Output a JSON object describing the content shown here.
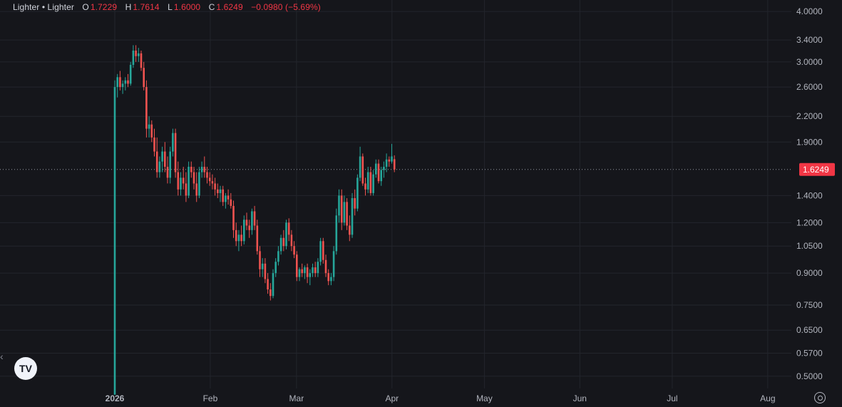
{
  "legend": {
    "symbol": "Lighter • Lighter",
    "open_label": "O",
    "open": "1.7229",
    "high_label": "H",
    "high": "1.7614",
    "low_label": "L",
    "low": "1.6000",
    "close_label": "C",
    "close": "1.6249",
    "change": "−0.0980 (−5.69%)"
  },
  "last_price_label": "1.6249",
  "icons": {
    "logo": "tradingview-logo-icon",
    "settings": "gear-icon",
    "collapse": "chevron-left-icon"
  },
  "colors": {
    "up": "#26a69a",
    "down": "#ef5350",
    "last_price": "#f23645",
    "background": "#15161b",
    "grid": "#23252c"
  },
  "chart_data": {
    "type": "candlestick",
    "y_scale": "log",
    "ylim": [
      0.47,
      4.1
    ],
    "y_ticks": [
      {
        "value": 4.0,
        "label": "4.0000"
      },
      {
        "value": 3.4,
        "label": "3.4000"
      },
      {
        "value": 3.0,
        "label": "3.0000"
      },
      {
        "value": 2.6,
        "label": "2.6000"
      },
      {
        "value": 2.2,
        "label": "2.2000"
      },
      {
        "value": 1.9,
        "label": "1.9000"
      },
      {
        "value": 1.4,
        "label": "1.4000"
      },
      {
        "value": 1.2,
        "label": "1.2000"
      },
      {
        "value": 1.05,
        "label": "1.0500"
      },
      {
        "value": 0.9,
        "label": "0.9000"
      },
      {
        "value": 0.75,
        "label": "0.7500"
      },
      {
        "value": 0.65,
        "label": "0.6500"
      },
      {
        "value": 0.57,
        "label": "0.5700"
      },
      {
        "value": 0.5,
        "label": "0.5000"
      }
    ],
    "x_ticks": [
      {
        "date": "2026-01-01",
        "label": "2026",
        "bold": true
      },
      {
        "date": "2026-02-01",
        "label": "Feb"
      },
      {
        "date": "2026-03-01",
        "label": "Mar"
      },
      {
        "date": "2026-04-01",
        "label": "Apr"
      },
      {
        "date": "2026-05-01",
        "label": "May"
      },
      {
        "date": "2026-06-01",
        "label": "Jun"
      },
      {
        "date": "2026-07-01",
        "label": "Jul"
      },
      {
        "date": "2026-08-01",
        "label": "Aug"
      }
    ],
    "last_price": 1.6249,
    "start_date": "2026-01-01",
    "candles": [
      [
        0.45,
        2.7,
        0.45,
        2.6
      ],
      [
        2.6,
        2.8,
        2.45,
        2.75
      ],
      [
        2.75,
        2.85,
        2.55,
        2.6
      ],
      [
        2.6,
        2.7,
        2.5,
        2.65
      ],
      [
        2.65,
        2.75,
        2.55,
        2.7
      ],
      [
        2.7,
        2.8,
        2.6,
        2.65
      ],
      [
        2.65,
        3.0,
        2.62,
        2.95
      ],
      [
        2.95,
        3.3,
        2.9,
        3.2
      ],
      [
        3.2,
        3.3,
        3.0,
        3.1
      ],
      [
        3.1,
        3.25,
        3.0,
        3.15
      ],
      [
        3.15,
        3.2,
        2.85,
        2.9
      ],
      [
        2.9,
        3.0,
        2.55,
        2.6
      ],
      [
        2.6,
        2.7,
        1.95,
        2.05
      ],
      [
        2.05,
        2.2,
        1.95,
        2.1
      ],
      [
        2.1,
        2.15,
        1.9,
        1.95
      ],
      [
        1.95,
        2.05,
        1.75,
        1.8
      ],
      [
        1.8,
        1.95,
        1.55,
        1.6
      ],
      [
        1.6,
        1.75,
        1.55,
        1.7
      ],
      [
        1.7,
        1.85,
        1.6,
        1.8
      ],
      [
        1.8,
        1.9,
        1.6,
        1.65
      ],
      [
        1.65,
        1.75,
        1.5,
        1.55
      ],
      [
        1.55,
        1.85,
        1.5,
        1.8
      ],
      [
        1.8,
        2.05,
        1.75,
        2.0
      ],
      [
        2.0,
        2.05,
        1.55,
        1.6
      ],
      [
        1.6,
        1.7,
        1.4,
        1.45
      ],
      [
        1.45,
        1.6,
        1.4,
        1.55
      ],
      [
        1.55,
        1.65,
        1.45,
        1.5
      ],
      [
        1.5,
        1.6,
        1.35,
        1.4
      ],
      [
        1.4,
        1.7,
        1.38,
        1.65
      ],
      [
        1.65,
        1.7,
        1.55,
        1.6
      ],
      [
        1.6,
        1.65,
        1.45,
        1.5
      ],
      [
        1.5,
        1.6,
        1.35,
        1.4
      ],
      [
        1.4,
        1.65,
        1.38,
        1.6
      ],
      [
        1.6,
        1.7,
        1.55,
        1.65
      ],
      [
        1.65,
        1.75,
        1.55,
        1.6
      ],
      [
        1.6,
        1.65,
        1.5,
        1.55
      ],
      [
        1.55,
        1.6,
        1.48,
        1.52
      ],
      [
        1.52,
        1.58,
        1.45,
        1.5
      ],
      [
        1.5,
        1.55,
        1.4,
        1.45
      ],
      [
        1.45,
        1.5,
        1.38,
        1.42
      ],
      [
        1.42,
        1.48,
        1.35,
        1.45
      ],
      [
        1.45,
        1.48,
        1.32,
        1.35
      ],
      [
        1.35,
        1.42,
        1.3,
        1.4
      ],
      [
        1.4,
        1.45,
        1.33,
        1.37
      ],
      [
        1.37,
        1.42,
        1.3,
        1.32
      ],
      [
        1.32,
        1.36,
        1.1,
        1.15
      ],
      [
        1.15,
        1.2,
        1.05,
        1.08
      ],
      [
        1.08,
        1.15,
        1.02,
        1.12
      ],
      [
        1.12,
        1.18,
        1.05,
        1.08
      ],
      [
        1.08,
        1.25,
        1.06,
        1.22
      ],
      [
        1.22,
        1.27,
        1.15,
        1.18
      ],
      [
        1.18,
        1.22,
        1.1,
        1.15
      ],
      [
        1.15,
        1.3,
        1.12,
        1.28
      ],
      [
        1.28,
        1.32,
        1.15,
        1.18
      ],
      [
        1.18,
        1.22,
        1.0,
        1.02
      ],
      [
        1.02,
        1.05,
        0.88,
        0.92
      ],
      [
        0.92,
        0.98,
        0.88,
        0.95
      ],
      [
        0.95,
        0.98,
        0.85,
        0.87
      ],
      [
        0.87,
        0.9,
        0.8,
        0.82
      ],
      [
        0.82,
        0.85,
        0.77,
        0.79
      ],
      [
        0.79,
        0.92,
        0.78,
        0.9
      ],
      [
        0.9,
        0.98,
        0.88,
        0.96
      ],
      [
        0.96,
        1.05,
        0.94,
        1.02
      ],
      [
        1.02,
        1.12,
        1.0,
        1.1
      ],
      [
        1.1,
        1.15,
        1.02,
        1.05
      ],
      [
        1.05,
        1.22,
        1.03,
        1.2
      ],
      [
        1.2,
        1.23,
        1.08,
        1.12
      ],
      [
        1.12,
        1.15,
        1.02,
        1.05
      ],
      [
        1.05,
        1.08,
        0.98,
        1.0
      ],
      [
        1.0,
        1.02,
        0.86,
        0.88
      ],
      [
        0.88,
        0.93,
        0.86,
        0.92
      ],
      [
        0.92,
        0.95,
        0.88,
        0.9
      ],
      [
        0.9,
        0.94,
        0.87,
        0.93
      ],
      [
        0.93,
        0.95,
        0.85,
        0.88
      ],
      [
        0.88,
        0.92,
        0.84,
        0.9
      ],
      [
        0.9,
        0.95,
        0.88,
        0.93
      ],
      [
        0.93,
        0.96,
        0.88,
        0.9
      ],
      [
        0.9,
        0.98,
        0.88,
        0.96
      ],
      [
        0.96,
        1.1,
        0.94,
        1.08
      ],
      [
        1.08,
        1.1,
        0.95,
        0.97
      ],
      [
        0.97,
        1.0,
        0.88,
        0.9
      ],
      [
        0.9,
        0.92,
        0.84,
        0.86
      ],
      [
        0.86,
        0.9,
        0.84,
        0.88
      ],
      [
        0.88,
        1.05,
        0.86,
        1.02
      ],
      [
        1.02,
        1.3,
        1.0,
        1.25
      ],
      [
        1.25,
        1.45,
        1.2,
        1.4
      ],
      [
        1.4,
        1.45,
        1.15,
        1.2
      ],
      [
        1.2,
        1.4,
        1.18,
        1.35
      ],
      [
        1.35,
        1.38,
        1.15,
        1.18
      ],
      [
        1.18,
        1.25,
        1.08,
        1.12
      ],
      [
        1.12,
        1.42,
        1.1,
        1.38
      ],
      [
        1.38,
        1.45,
        1.25,
        1.3
      ],
      [
        1.3,
        1.58,
        1.28,
        1.55
      ],
      [
        1.55,
        1.85,
        1.52,
        1.75
      ],
      [
        1.75,
        1.78,
        1.48,
        1.5
      ],
      [
        1.5,
        1.55,
        1.4,
        1.45
      ],
      [
        1.45,
        1.65,
        1.42,
        1.6
      ],
      [
        1.6,
        1.65,
        1.4,
        1.42
      ],
      [
        1.42,
        1.62,
        1.4,
        1.58
      ],
      [
        1.58,
        1.72,
        1.55,
        1.68
      ],
      [
        1.68,
        1.72,
        1.5,
        1.52
      ],
      [
        1.52,
        1.65,
        1.48,
        1.62
      ],
      [
        1.62,
        1.7,
        1.55,
        1.65
      ],
      [
        1.65,
        1.78,
        1.6,
        1.72
      ],
      [
        1.72,
        1.75,
        1.65,
        1.7
      ],
      [
        1.7,
        1.88,
        1.68,
        1.75
      ],
      [
        1.7229,
        1.7614,
        1.6,
        1.6249
      ]
    ]
  }
}
